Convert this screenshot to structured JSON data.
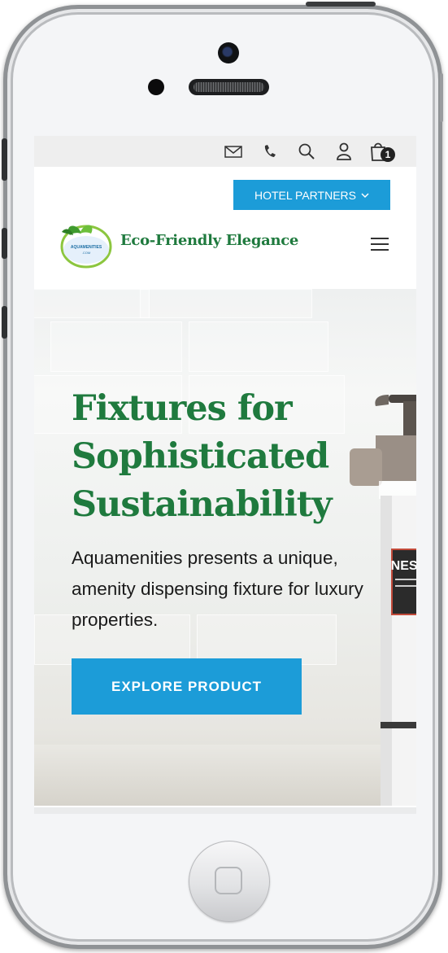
{
  "top_bar": {
    "icons": [
      "mail-icon",
      "phone-icon",
      "search-icon",
      "account-icon",
      "cart-icon"
    ],
    "cart_count": "1"
  },
  "header": {
    "partners_label": "HOTEL PARTNERS",
    "tagline": "Eco-Friendly Elegance",
    "logo_text": "AQUAMENITIES .COM"
  },
  "hero": {
    "title": "Fixtures for Sophisticated Sustainability",
    "description": "Aquamenities presents a unique, amenity dispensing fixture for luxury properties.",
    "cta_label": "EXPLORE PRODUCT",
    "bottle_label": "NEST"
  },
  "colors": {
    "brand_green": "#1f7a3e",
    "accent_blue": "#1c9cd8"
  }
}
